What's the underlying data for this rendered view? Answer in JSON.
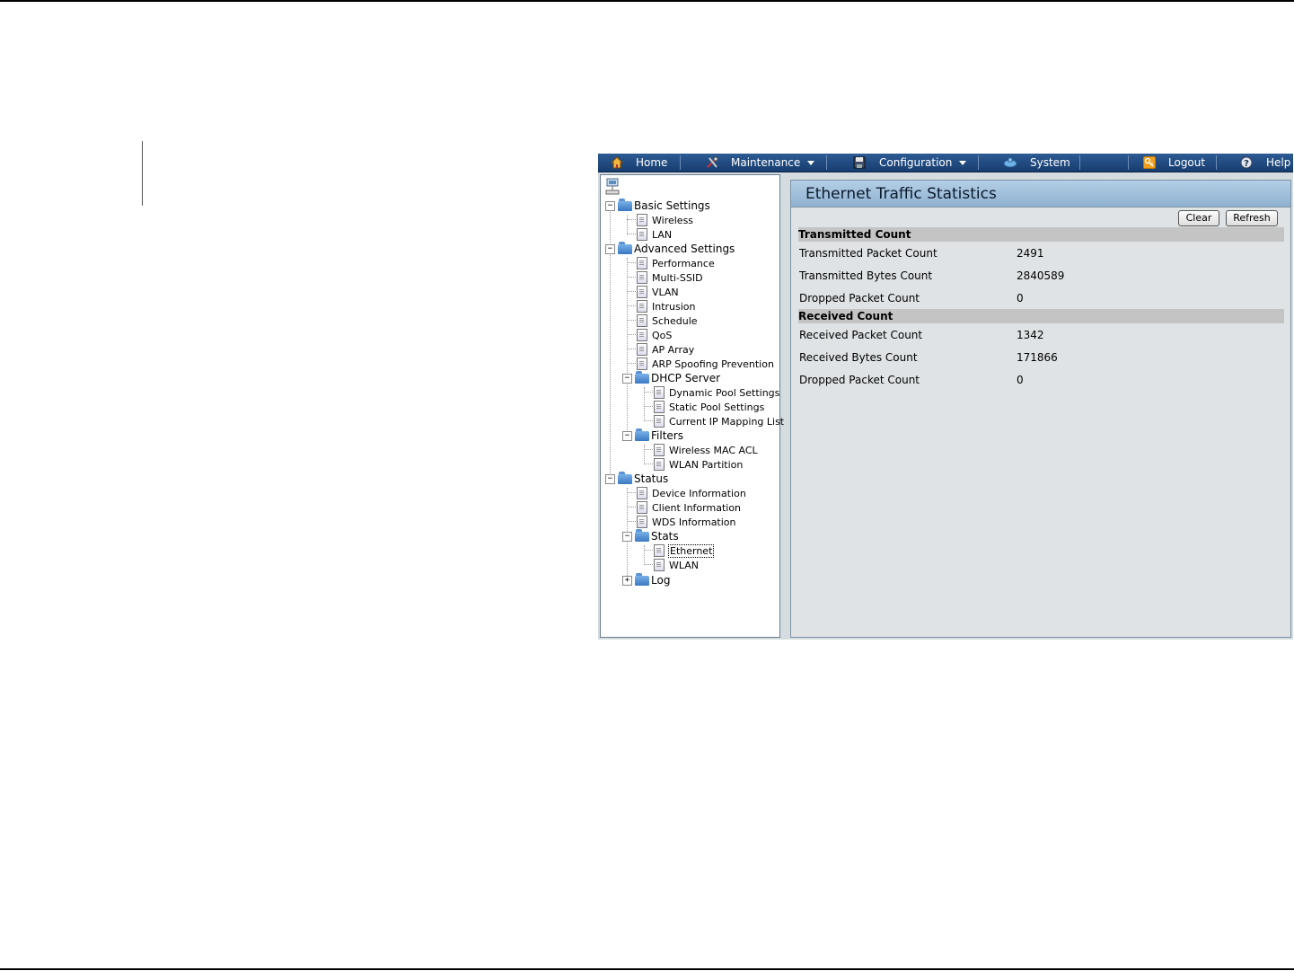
{
  "menu": {
    "items": [
      {
        "label": "Home",
        "icon": "home-icon"
      },
      {
        "label": "Maintenance",
        "icon": "tools-icon",
        "dropdown": true
      },
      {
        "label": "Configuration",
        "icon": "save-icon",
        "dropdown": true
      },
      {
        "label": "System",
        "icon": "system-icon"
      },
      {
        "label": "Logout",
        "icon": "key-icon"
      },
      {
        "label": "Help",
        "icon": "help-icon"
      }
    ]
  },
  "tree": {
    "basic_settings": "Basic Settings",
    "wireless": "Wireless",
    "lan": "LAN",
    "advanced_settings": "Advanced Settings",
    "performance": "Performance",
    "multi_ssid": "Multi-SSID",
    "vlan": "VLAN",
    "intrusion": "Intrusion",
    "schedule": "Schedule",
    "qos": "QoS",
    "ap_array": "AP Array",
    "arp_spoofing": "ARP Spoofing Prevention",
    "dhcp_server": "DHCP Server",
    "dynamic_pool": "Dynamic Pool Settings",
    "static_pool": "Static Pool Settings",
    "ip_mapping": "Current IP Mapping List",
    "filters": "Filters",
    "wireless_mac_acl": "Wireless MAC ACL",
    "wlan_partition": "WLAN Partition",
    "status": "Status",
    "device_info": "Device Information",
    "client_info": "Client Information",
    "wds_info": "WDS Information",
    "stats": "Stats",
    "ethernet": "Ethernet",
    "wlan": "WLAN",
    "log": "Log"
  },
  "panel": {
    "title": "Ethernet Traffic Statistics",
    "clear_label": "Clear",
    "refresh_label": "Refresh",
    "transmitted": {
      "heading": "Transmitted Count",
      "rows": [
        {
          "label": "Transmitted Packet Count",
          "value": "2491"
        },
        {
          "label": "Transmitted Bytes Count",
          "value": "2840589"
        },
        {
          "label": "Dropped Packet Count",
          "value": "0"
        }
      ]
    },
    "received": {
      "heading": "Received Count",
      "rows": [
        {
          "label": "Received Packet Count",
          "value": "1342"
        },
        {
          "label": "Received Bytes Count",
          "value": "171866"
        },
        {
          "label": "Dropped Packet Count",
          "value": "0"
        }
      ]
    }
  },
  "colors": {
    "menubar": "#173d6f",
    "title_bar": "#8fb2d0",
    "section_header": "#c4c4c4"
  }
}
